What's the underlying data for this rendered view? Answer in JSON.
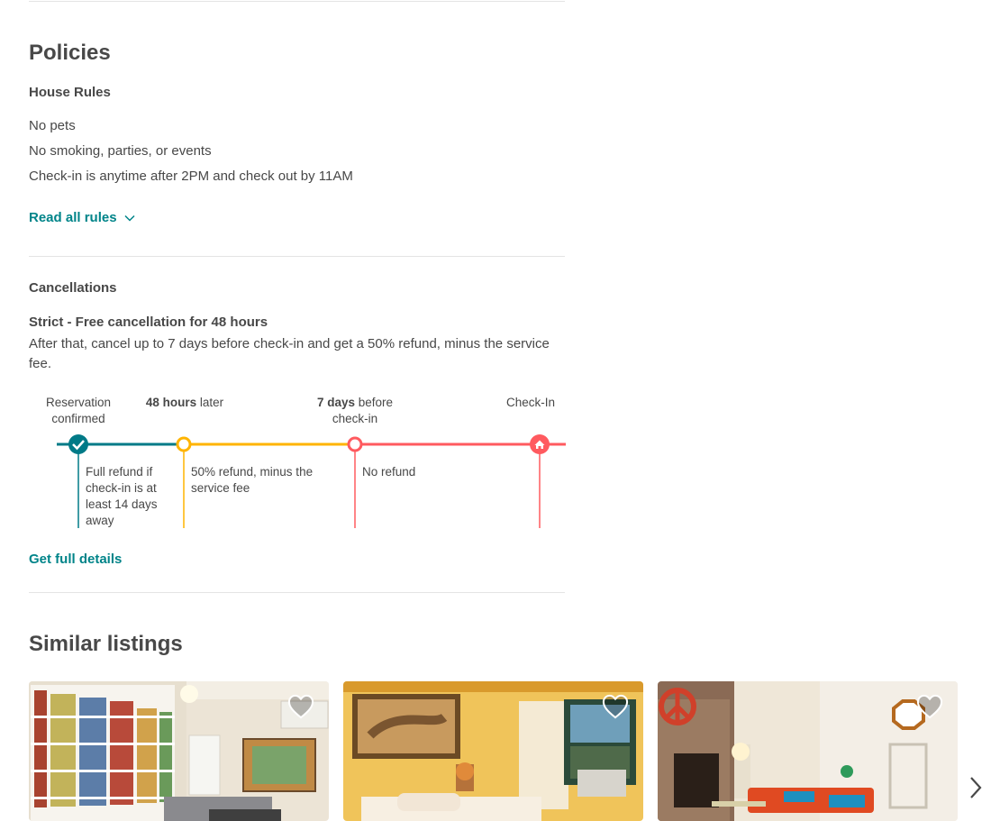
{
  "policies": {
    "title": "Policies",
    "house_rules": {
      "heading": "House Rules",
      "rules": [
        "No pets",
        "No smoking, parties, or events",
        "Check-in is anytime after 2PM and check out by 11AM"
      ],
      "read_all": "Read all rules"
    },
    "cancellations": {
      "heading": "Cancellations",
      "policy_title": "Strict - Free cancellation for 48 hours",
      "description": "After that, cancel up to 7 days before check-in and get a 50% refund, minus the service fee.",
      "timeline": {
        "points": [
          {
            "label": "Reservation confirmed",
            "bold": "",
            "rest": ""
          },
          {
            "label": "",
            "bold": "48 hours",
            "rest": " later"
          },
          {
            "label": "",
            "bold": "7 days",
            "rest": " before check-in"
          },
          {
            "label": "Check-In",
            "bold": "",
            "rest": ""
          }
        ],
        "segments": [
          {
            "text": "Full refund if check-in is at least 14 days away",
            "color": "#007a87"
          },
          {
            "text": "50% refund, minus the service fee",
            "color": "#ffb400"
          },
          {
            "text": "No refund",
            "color": "#ff5a5f"
          }
        ]
      },
      "details_link": "Get full details"
    }
  },
  "similar": {
    "title": "Similar listings",
    "listings": [
      {
        "image": "living-room-bookshelves"
      },
      {
        "image": "bedroom-yellow-walls"
      },
      {
        "image": "living-room-orange-sofa"
      }
    ]
  },
  "colors": {
    "accent_link": "#008489",
    "teal": "#007a87",
    "yellow": "#ffb400",
    "red": "#ff5a5f"
  }
}
